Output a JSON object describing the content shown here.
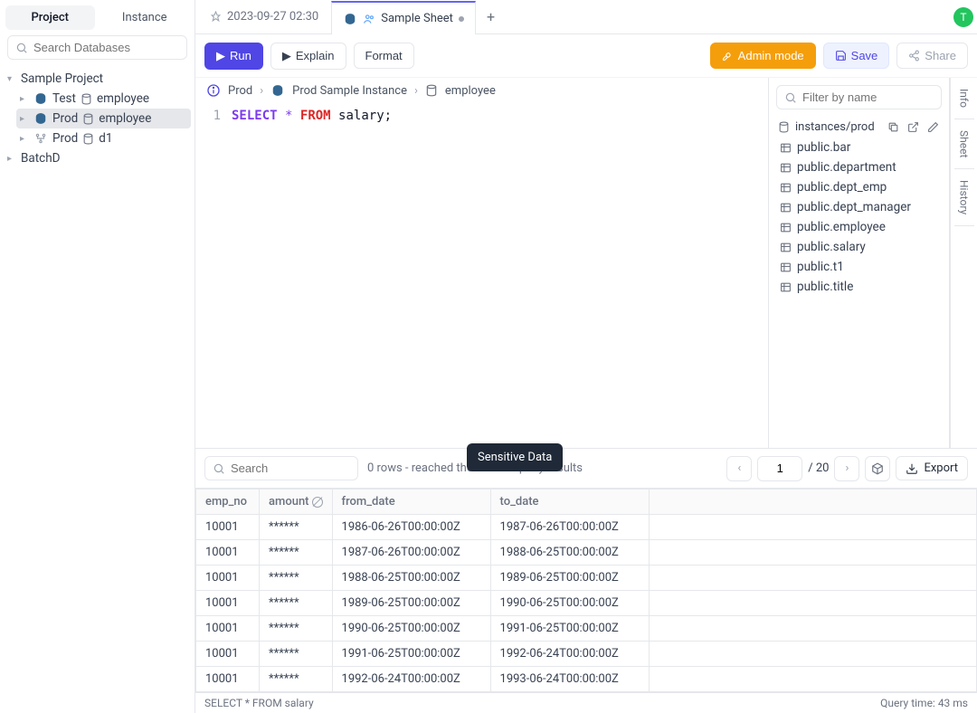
{
  "avatar_initial": "T",
  "sidebar": {
    "tabs": {
      "project": "Project",
      "instance": "Instance"
    },
    "search_placeholder": "Search Databases",
    "tree": {
      "project_name": "Sample Project",
      "items": [
        {
          "env": "Test",
          "db": "employee"
        },
        {
          "env": "Prod",
          "db": "employee"
        },
        {
          "env": "Prod",
          "db": "d1"
        }
      ],
      "project2": "BatchD"
    }
  },
  "editor_tabs": [
    {
      "label": "2023-09-27 02:30"
    },
    {
      "label": "Sample Sheet",
      "active": true
    }
  ],
  "toolbar": {
    "run": "Run",
    "explain": "Explain",
    "format": "Format",
    "admin": "Admin mode",
    "save": "Save",
    "share": "Share"
  },
  "breadcrumb": {
    "env": "Prod",
    "instance": "Prod Sample Instance",
    "db": "employee"
  },
  "code": {
    "line_no": "1",
    "select": "SELECT",
    "star": "*",
    "from": "FROM",
    "ident": "salary;"
  },
  "schema": {
    "filter_placeholder": "Filter by name",
    "path": "instances/prod",
    "tables": [
      "public.bar",
      "public.department",
      "public.dept_emp",
      "public.dept_manager",
      "public.employee",
      "public.salary",
      "public.t1",
      "public.title"
    ]
  },
  "rail": {
    "info": "Info",
    "sheet": "Sheet",
    "history": "History"
  },
  "results": {
    "search_placeholder": "Search",
    "info_text": "0 rows  -  reached the limit of query results",
    "page": "1",
    "total_pages": "/ 20",
    "export": "Export",
    "tooltip": "Sensitive Data",
    "columns": {
      "emp_no": "emp_no",
      "amount": "amount",
      "from_date": "from_date",
      "to_date": "to_date"
    },
    "rows": [
      {
        "emp_no": "10001",
        "amount": "******",
        "from_date": "1986-06-26T00:00:00Z",
        "to_date": "1987-06-26T00:00:00Z"
      },
      {
        "emp_no": "10001",
        "amount": "******",
        "from_date": "1987-06-26T00:00:00Z",
        "to_date": "1988-06-25T00:00:00Z"
      },
      {
        "emp_no": "10001",
        "amount": "******",
        "from_date": "1988-06-25T00:00:00Z",
        "to_date": "1989-06-25T00:00:00Z"
      },
      {
        "emp_no": "10001",
        "amount": "******",
        "from_date": "1989-06-25T00:00:00Z",
        "to_date": "1990-06-25T00:00:00Z"
      },
      {
        "emp_no": "10001",
        "amount": "******",
        "from_date": "1990-06-25T00:00:00Z",
        "to_date": "1991-06-25T00:00:00Z"
      },
      {
        "emp_no": "10001",
        "amount": "******",
        "from_date": "1991-06-25T00:00:00Z",
        "to_date": "1992-06-24T00:00:00Z"
      },
      {
        "emp_no": "10001",
        "amount": "******",
        "from_date": "1992-06-24T00:00:00Z",
        "to_date": "1993-06-24T00:00:00Z"
      }
    ]
  },
  "statusbar": {
    "query": "SELECT * FROM salary",
    "time": "Query time: 43 ms"
  }
}
